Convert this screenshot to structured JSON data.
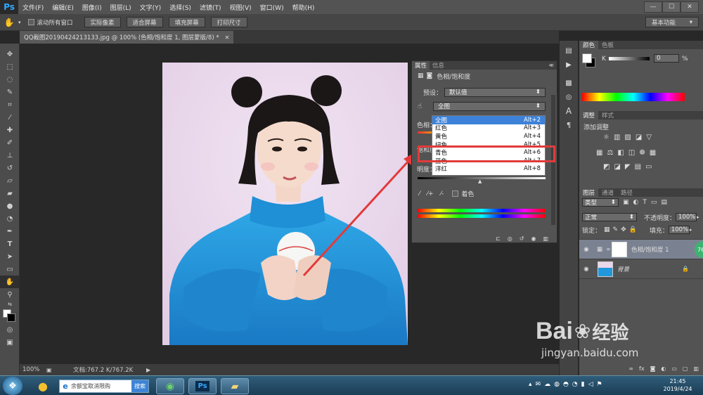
{
  "app": {
    "logo": "Ps",
    "menus": [
      "文件(F)",
      "编辑(E)",
      "图像(I)",
      "图层(L)",
      "文字(Y)",
      "选择(S)",
      "滤镜(T)",
      "视图(V)",
      "窗口(W)",
      "帮助(H)"
    ],
    "window_controls": [
      "—",
      "☐",
      "✕"
    ]
  },
  "options": {
    "scroll_all_label": "滚动所有窗口",
    "buttons": [
      "实际像素",
      "适合屏幕",
      "填充屏幕",
      "打印尺寸"
    ],
    "workspace": "基本功能"
  },
  "document": {
    "tab_title": "QQ截图20190424213133.jpg @ 100% (色相/饱和度 1, 图层蒙版/8) *",
    "tab_close": "✕"
  },
  "status": {
    "zoom": "100%",
    "doc_info": "文档:767.2 K/767.2K"
  },
  "properties": {
    "tabs": [
      "属性",
      "信息"
    ],
    "title": "色相/饱和度",
    "preset_label": "预设：",
    "preset_value": "默认值",
    "channel_value": "全图",
    "hue_label": "色相：",
    "saturation_label": "饱和度",
    "lightness_label": "明度：",
    "colorize_label": "着色",
    "channel_options": [
      {
        "label": "全图",
        "shortcut": "Alt+2"
      },
      {
        "label": "红色",
        "shortcut": "Alt+3"
      },
      {
        "label": "黄色",
        "shortcut": "Alt+4"
      },
      {
        "label": "绿色",
        "shortcut": "Alt+5"
      },
      {
        "label": "青色",
        "shortcut": "Alt+6"
      },
      {
        "label": "蓝色",
        "shortcut": "Alt+7"
      },
      {
        "label": "洋红",
        "shortcut": "Alt+8"
      }
    ],
    "selected_option": "全图",
    "highlighted_option": "青色"
  },
  "color_panel": {
    "tabs": [
      "颜色",
      "色板"
    ],
    "channel_label": "K",
    "value": "0",
    "unit": "%"
  },
  "adjust_panel": {
    "tabs": [
      "调整",
      "样式"
    ],
    "title": "添加调整"
  },
  "layers_panel": {
    "tabs": [
      "图层",
      "通道",
      "路径"
    ],
    "filter": "类型",
    "blend_mode": "正常",
    "opacity_label": "不透明度：",
    "opacity_value": "100%",
    "lock_label": "锁定：",
    "fill_label": "填充：",
    "fill_value": "100%",
    "layers": [
      {
        "name": "色相/饱和度 1",
        "visible": true,
        "selected": true
      },
      {
        "name": "背景",
        "visible": true,
        "selected": false
      }
    ],
    "badge": "76"
  },
  "taskbar": {
    "search_placeholder": "余额宝取消限购",
    "search_button": "搜索",
    "clock_time": "21:45",
    "clock_date": "2019/4/24"
  },
  "watermark": {
    "brand": "Bai",
    "brand_cn": "经验",
    "url": "jingyan.baidu.com"
  },
  "colors": {
    "ps_blue": "#31a8ff",
    "highlight_red": "#e23a3a",
    "selection_blue": "#3d82d8"
  }
}
